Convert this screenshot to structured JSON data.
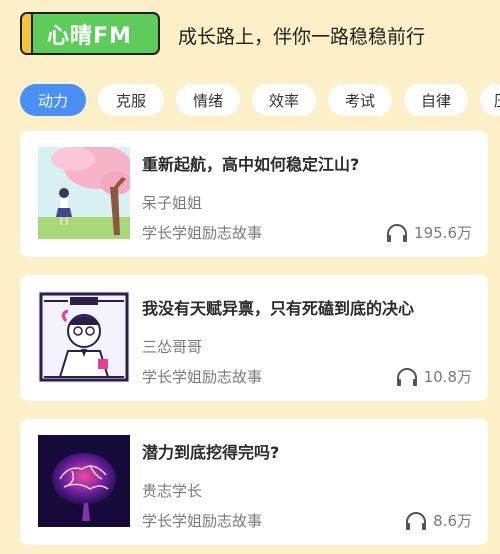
{
  "header": {
    "logo_text": "心晴FM",
    "slogan": "成长路上，伴你一路稳稳前行"
  },
  "tabs": [
    {
      "label": "动力",
      "active": true
    },
    {
      "label": "克服",
      "active": false
    },
    {
      "label": "情绪",
      "active": false
    },
    {
      "label": "效率",
      "active": false
    },
    {
      "label": "考试",
      "active": false
    },
    {
      "label": "自律",
      "active": false
    },
    {
      "label": "压",
      "active": false
    }
  ],
  "cards": [
    {
      "title": "重新起航，高中如何稳定江山?",
      "author": "呆子姐姐",
      "category": "学长学姐励志故事",
      "plays": "195.6万"
    },
    {
      "title": "我没有天赋异禀，只有死磕到底的决心",
      "author": "三怂哥哥",
      "category": "学长学姐励志故事",
      "plays": "10.8万"
    },
    {
      "title": "潜力到底挖得完吗?",
      "author": "贵志学长",
      "category": "学长学姐励志故事",
      "plays": "8.6万"
    }
  ],
  "colors": {
    "accent": "#4a8ff5",
    "logo_green": "#5dcc5b",
    "background": "#fdf0c8"
  }
}
